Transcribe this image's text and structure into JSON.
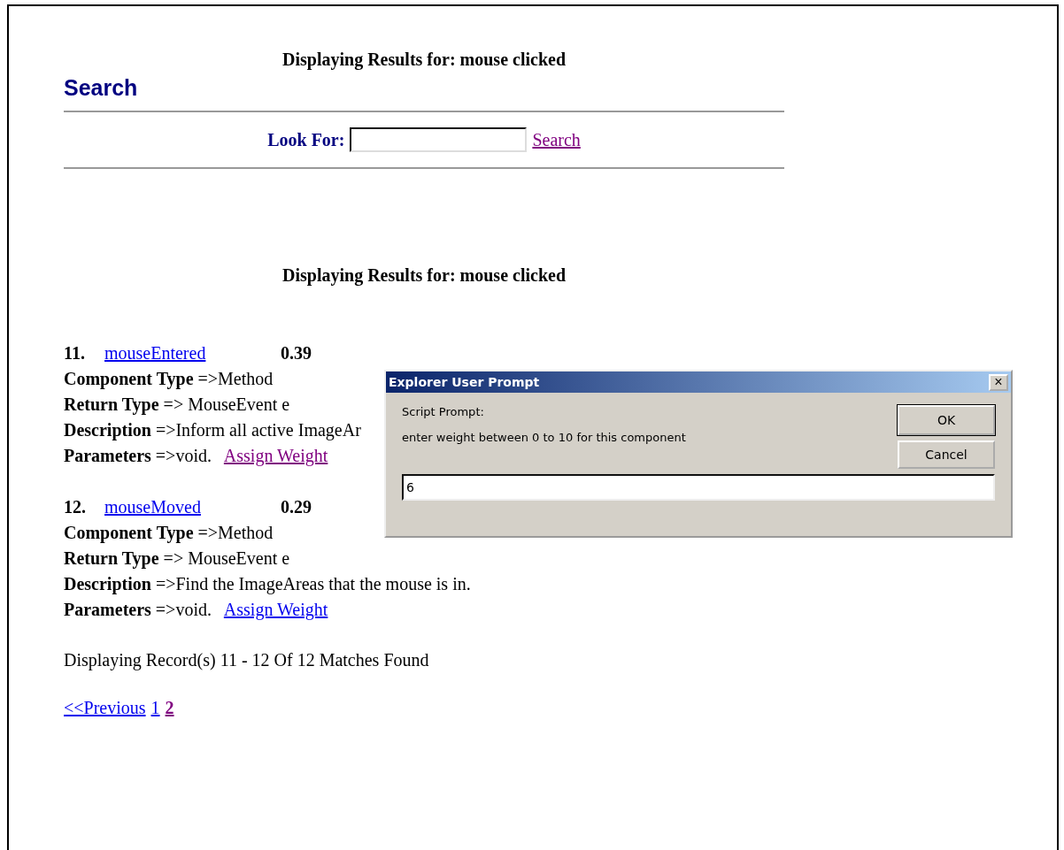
{
  "header": {
    "results_title": "Displaying Results for: mouse clicked",
    "heading": "Search"
  },
  "search": {
    "label": "Look For:",
    "link": {
      "label": "Search",
      "visited": true
    }
  },
  "results_title": "Displaying Results for: mouse clicked",
  "results": [
    {
      "number": "11.",
      "name": {
        "label": "mouseEntered",
        "visited": false
      },
      "score": "0.39",
      "fields": [
        {
          "label": "Component Type",
          "value": "=>Method"
        },
        {
          "label": "Return Type",
          "value": "=> MouseEvent e"
        },
        {
          "label": "Description",
          "value": "=>Inform all active ImageAr"
        },
        {
          "label": "Parameters",
          "value": "=>void."
        }
      ],
      "assign": {
        "label": "Assign Weight",
        "visited": true
      }
    },
    {
      "number": "12.",
      "name": {
        "label": "mouseMoved",
        "visited": false
      },
      "score": "0.29",
      "fields": [
        {
          "label": "Component Type",
          "value": "=>Method"
        },
        {
          "label": "Return Type",
          "value": "=> MouseEvent e"
        },
        {
          "label": "Description",
          "value": "=>Find the ImageAreas that the mouse is in."
        },
        {
          "label": "Parameters",
          "value": "=>void."
        }
      ],
      "assign": {
        "label": "Assign Weight",
        "visited": false
      }
    }
  ],
  "record_count": "Displaying Record(s) 11 - 12 Of 12 Matches Found",
  "pager": {
    "previous": "<<Previous",
    "pages": [
      {
        "label": "1",
        "selected": false
      },
      {
        "label": "2",
        "selected": true
      }
    ]
  },
  "dialog": {
    "title": "Explorer User Prompt",
    "close": "×",
    "caption": "Script Prompt:",
    "message": "enter weight between 0 to 10 for this component",
    "value": "6",
    "buttons": [
      {
        "label": "OK",
        "default": true
      },
      {
        "label": "Cancel",
        "default": false
      }
    ]
  }
}
